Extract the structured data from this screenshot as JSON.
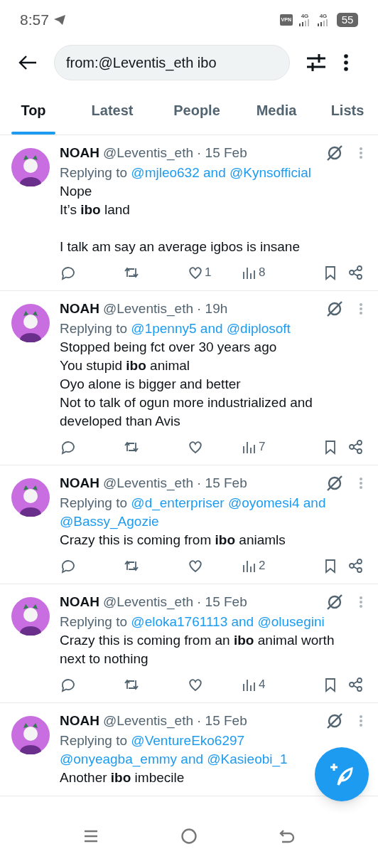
{
  "status_bar": {
    "time": "8:57",
    "vpn": "VPN",
    "networks": [
      "4G",
      "4G"
    ],
    "battery": "55"
  },
  "search": {
    "value": "from:@Leventis_eth ibo"
  },
  "tabs": [
    {
      "label": "Top",
      "selected": true
    },
    {
      "label": "Latest",
      "selected": false
    },
    {
      "label": "People",
      "selected": false
    },
    {
      "label": "Media",
      "selected": false
    },
    {
      "label": "Lists",
      "selected": false
    }
  ],
  "tweets": [
    {
      "name": "NOAH",
      "handle": "@Leventis_eth",
      "time": "· 15 Feb",
      "reply_prefix": "Replying to",
      "mentions": [
        "@mjleo632",
        "@Kynsofficial"
      ],
      "joiner": "and",
      "body": "Nope\nIt’s **ibo** land\n\nI talk am say an average igbos is insane",
      "likes": "1",
      "views": "8"
    },
    {
      "name": "NOAH",
      "handle": "@Leventis_eth",
      "time": "· 19h",
      "reply_prefix": "Replying to",
      "mentions": [
        "@1penny5",
        "@diplosoft"
      ],
      "joiner": "and",
      "body": "Stopped being fct over 30 years ago\nYou stupid **ibo** animal\nOyo alone is bigger and better\nNot to talk of ogun more industrialized and developed than Avis",
      "views": "7"
    },
    {
      "name": "NOAH",
      "handle": "@Leventis_eth",
      "time": "· 15 Feb",
      "reply_prefix": "Replying to",
      "mentions": [
        "@d_enterpriser",
        "@oyomesi4",
        "@Bassy_Agozie"
      ],
      "joiner": "and",
      "body": "Crazy this is coming from **ibo** aniamls",
      "views": "2"
    },
    {
      "name": "NOAH",
      "handle": "@Leventis_eth",
      "time": "· 15 Feb",
      "reply_prefix": "Replying to",
      "mentions": [
        "@eloka1761113",
        "@olusegini"
      ],
      "joiner": "and",
      "body": "Crazy this is coming from an **ibo** animal worth next to nothing",
      "views": "4"
    },
    {
      "name": "NOAH",
      "handle": "@Leventis_eth",
      "time": "· 15 Feb",
      "reply_prefix": "Replying to",
      "mentions": [
        "@VentureEko6297",
        "@onyeagba_emmy",
        "@Kasieobi_1"
      ],
      "joiner": "and",
      "body": "Another **ibo** imbecile"
    }
  ]
}
